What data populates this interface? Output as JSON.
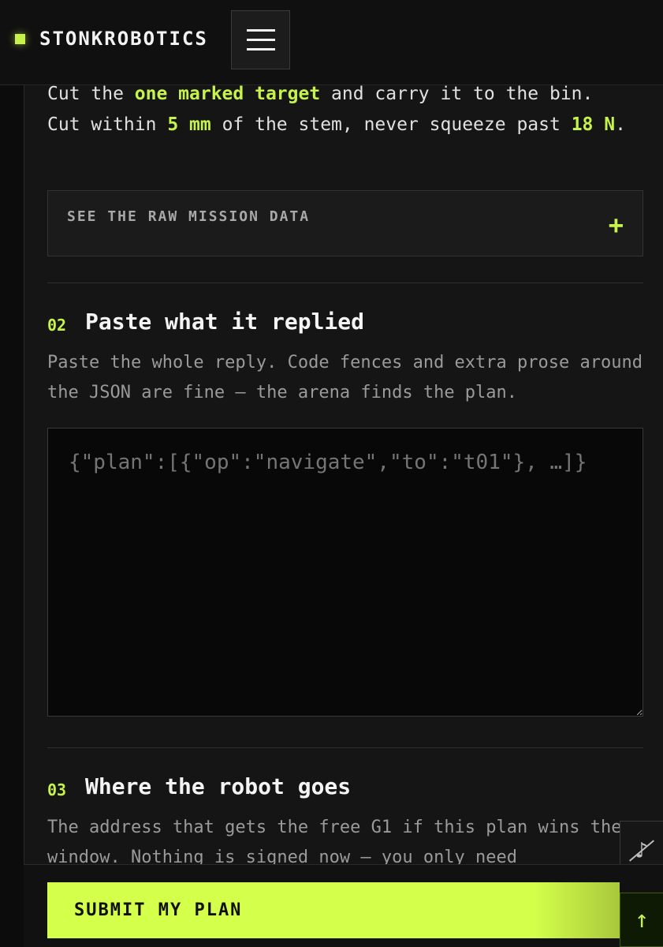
{
  "header": {
    "brand": "STONKROBOTICS",
    "menu_icon": "hamburger-icon"
  },
  "mission": {
    "line1_a": "Cut the ",
    "line1_hl": "one marked target",
    "line1_b": " and carry it to the bin.",
    "line2_a": "Cut within ",
    "line2_hl1": "5 mm",
    "line2_b": " of the stem, never squeeze past ",
    "line2_hl2": "18 N",
    "line2_c": "."
  },
  "accordion": {
    "label": "SEE THE RAW MISSION DATA",
    "toggle": "+"
  },
  "step2": {
    "number": "02",
    "title": "Paste what it replied",
    "description": "Paste the whole reply. Code fences and extra prose around the JSON are fine — the arena finds the plan.",
    "placeholder": "{\"plan\":[{\"op\":\"navigate\",\"to\":\"t01\"}, …]}"
  },
  "step3": {
    "number": "03",
    "title": "Where the robot goes",
    "description": "The address that gets the free G1 if this plan wins the window. Nothing is signed now — you only need"
  },
  "actions": {
    "submit_label": "SUBMIT MY PLAN",
    "scroll_top_glyph": "↑",
    "music_glyph": "♪"
  },
  "colors": {
    "accent": "#c6f24c",
    "background": "#0d0d0d",
    "card": "#151515"
  }
}
